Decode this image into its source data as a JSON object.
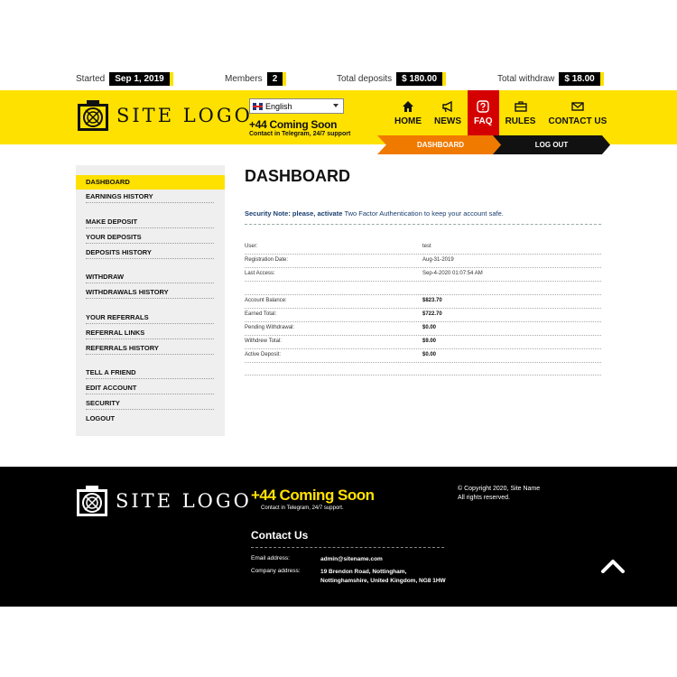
{
  "stats": {
    "started_label": "Started",
    "started_value": "Sep 1, 2019",
    "members_label": "Members",
    "members_value": "2",
    "deposits_label": "Total deposits",
    "deposits_value": "$ 180.00",
    "withdraw_label": "Total withdraw",
    "withdraw_value": "$ 18.00"
  },
  "header": {
    "logo_text": "SITE LOGO",
    "language": "English",
    "phone": "+44 Coming Soon",
    "phone_sub": "Contact in Telegram, 24/7 support",
    "accent_color": "#ffe100"
  },
  "nav": [
    {
      "label": "HOME",
      "icon": "home-icon"
    },
    {
      "label": "NEWS",
      "icon": "megaphone-icon"
    },
    {
      "label": "FAQ",
      "icon": "question-icon"
    },
    {
      "label": "RULES",
      "icon": "briefcase-icon"
    },
    {
      "label": "CONTACT US",
      "icon": "envelope-icon"
    }
  ],
  "subnav": {
    "dashboard": "DASHBOARD",
    "logout": "LOG OUT"
  },
  "sidebar": {
    "items": [
      "DASHBOARD",
      "EARNINGS HISTORY",
      "MAKE DEPOSIT",
      "YOUR DEPOSITS",
      "DEPOSITS HISTORY",
      "WITHDRAW",
      "WITHDRAWALS HISTORY",
      "YOUR REFERRALS",
      "REFERRAL LINKS",
      "REFERRALS HISTORY",
      "TELL A FRIEND",
      "EDIT ACCOUNT",
      "SECURITY",
      "LOGOUT"
    ]
  },
  "main": {
    "title": "DASHBOARD",
    "note_prefix": "Security Note: please, activate ",
    "note_link": "Two Factor Authentication",
    "note_suffix": " to keep your account safe.",
    "info": [
      {
        "k": "User:",
        "v": "test"
      },
      {
        "k": "Registration Date:",
        "v": "Aug-31-2019"
      },
      {
        "k": "Last Access:",
        "v": "Sep-4-2020 01:07:54 AM"
      }
    ],
    "balances": [
      {
        "k": "Account Balance:",
        "v": "$823.70"
      },
      {
        "k": "Earned Total:",
        "v": "$722.70"
      },
      {
        "k": "Pending Withdrawal:",
        "v": "$0.00"
      },
      {
        "k": "Withdrew Total:",
        "v": "$9.00"
      },
      {
        "k": "Active Deposit:",
        "v": "$0.00"
      }
    ]
  },
  "footer": {
    "logo_text": "SITE LOGO",
    "phone": "+44 Coming Soon",
    "phone_sub": "Contact in Telegram, 24/7 support.",
    "copyright_line1": "© Copyright 2020, Site Name",
    "copyright_line2": "All rights reserved.",
    "contact_title": "Contact Us",
    "email_label": "Email address:",
    "email_value": "admin@sitename.com",
    "address_label": "Company address:",
    "address_value": "19 Brendon Road, Nottingham, Nottinghamshire, United Kingdom, NG8 1HW"
  }
}
